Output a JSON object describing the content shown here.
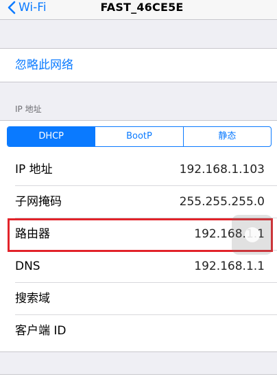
{
  "navbar": {
    "back_label": "Wi-Fi",
    "title": "FAST_46CE5E",
    "back_icon": "chevron-left-icon"
  },
  "forget": {
    "label": "忽略此网络"
  },
  "ip_section": {
    "header": "IP 地址",
    "tabs": [
      {
        "label": "DHCP",
        "selected": true
      },
      {
        "label": "BootP",
        "selected": false
      },
      {
        "label": "静态",
        "selected": false
      }
    ],
    "rows": [
      {
        "label": "IP 地址",
        "value": "192.168.1.103"
      },
      {
        "label": "子网掩码",
        "value": "255.255.255.0"
      },
      {
        "label": "路由器",
        "value": "192.168.1.1"
      },
      {
        "label": "DNS",
        "value": "192.168.1.1"
      },
      {
        "label": "搜索域",
        "value": ""
      },
      {
        "label": "客户端 ID",
        "value": ""
      }
    ]
  },
  "colors": {
    "accent": "#0a7aff",
    "highlight_border": "#e2232a",
    "background": "#efeff4"
  }
}
